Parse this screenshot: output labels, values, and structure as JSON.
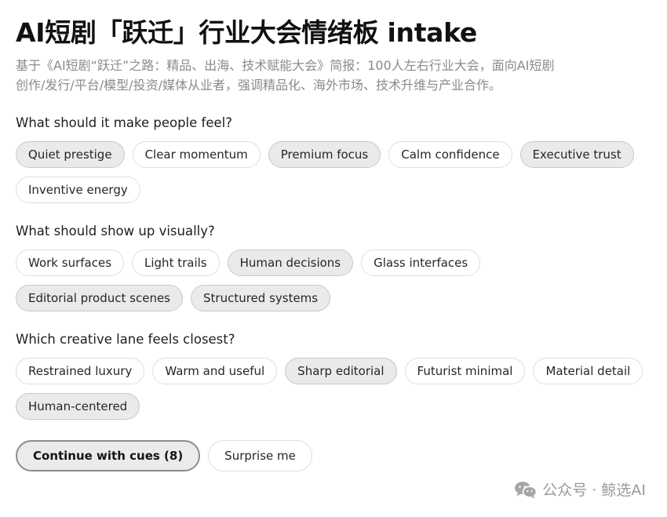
{
  "header": {
    "title": "AI短剧「跃迁」行业大会情绪板 intake",
    "brief": "基于《AI短剧“跃迁”之路：精品、出海、技术赋能大会》简报：100人左右行业大会，面向AI短剧创作/发行/平台/模型/投资/媒体从业者，强调精品化、海外市场、技术升维与产业合作。"
  },
  "sections": [
    {
      "question": "What should it make people feel?",
      "options": [
        {
          "label": "Quiet prestige",
          "selected": true
        },
        {
          "label": "Clear momentum",
          "selected": false
        },
        {
          "label": "Premium focus",
          "selected": true
        },
        {
          "label": "Calm confidence",
          "selected": false
        },
        {
          "label": "Executive trust",
          "selected": true
        },
        {
          "label": "Inventive energy",
          "selected": false
        }
      ]
    },
    {
      "question": "What should show up visually?",
      "options": [
        {
          "label": "Work surfaces",
          "selected": false
        },
        {
          "label": "Light trails",
          "selected": false
        },
        {
          "label": "Human decisions",
          "selected": true
        },
        {
          "label": "Glass interfaces",
          "selected": false
        },
        {
          "label": "Editorial product scenes",
          "selected": true
        },
        {
          "label": "Structured systems",
          "selected": true
        }
      ]
    },
    {
      "question": "Which creative lane feels closest?",
      "options": [
        {
          "label": "Restrained luxury",
          "selected": false
        },
        {
          "label": "Warm and useful",
          "selected": false
        },
        {
          "label": "Sharp editorial",
          "selected": true
        },
        {
          "label": "Futurist minimal",
          "selected": false
        },
        {
          "label": "Material detail",
          "selected": false
        },
        {
          "label": "Human-centered",
          "selected": true
        }
      ]
    }
  ],
  "actions": {
    "continue_label": "Continue with cues (8)",
    "surprise_label": "Surprise me"
  },
  "watermark": {
    "icon": "wechat-icon",
    "text": "公众号 · 鲸选AI"
  }
}
